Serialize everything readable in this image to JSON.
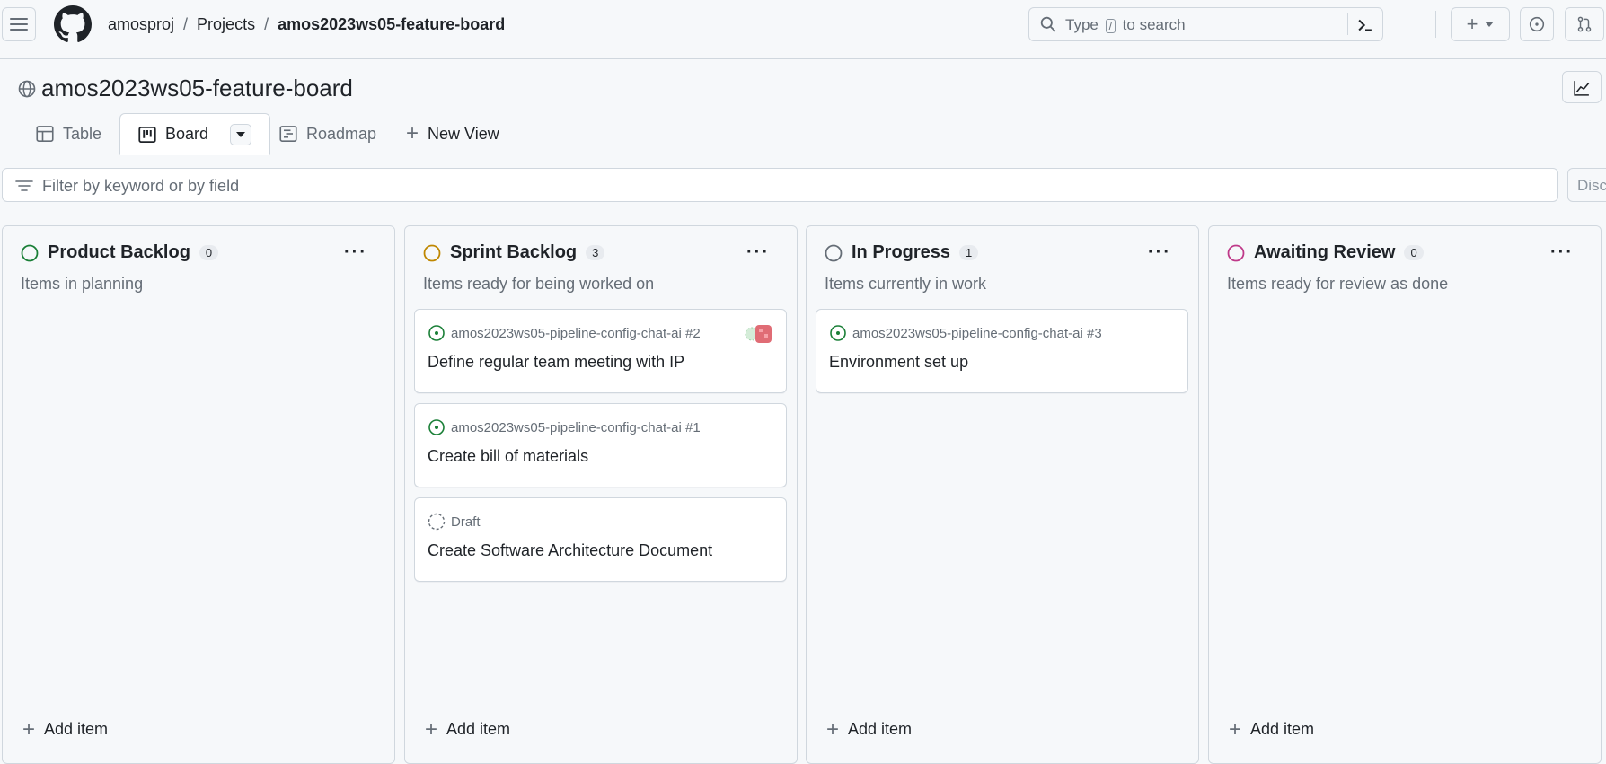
{
  "header": {
    "breadcrumbs": [
      "amosproj",
      "Projects",
      "amos2023ws05-feature-board"
    ],
    "search_prefix": "Type",
    "search_key": "/",
    "search_suffix": "to search"
  },
  "project": {
    "title": "amos2023ws05-feature-board"
  },
  "tabs": [
    {
      "label": "Table",
      "icon": "table-icon"
    },
    {
      "label": "Board",
      "icon": "board-icon",
      "active": true
    },
    {
      "label": "Roadmap",
      "icon": "roadmap-icon"
    },
    {
      "label": "New View",
      "icon": "plus-icon"
    }
  ],
  "filter": {
    "placeholder": "Filter by keyword or by field",
    "discard_label": "Discard"
  },
  "columns": [
    {
      "name": "Product Backlog",
      "count": "0",
      "description": "Items in planning",
      "status_color": "#1a7f37",
      "add_label": "Add item",
      "cards": []
    },
    {
      "name": "Sprint Backlog",
      "count": "3",
      "description": "Items ready for being worked on",
      "status_color": "#bf8700",
      "add_label": "Add item",
      "cards": [
        {
          "repo": "amos2023ws05-pipeline-config-chat-ai #2",
          "title": "Define regular team meeting with IP",
          "type": "issue",
          "has_avatar": true
        },
        {
          "repo": "amos2023ws05-pipeline-config-chat-ai #1",
          "title": "Create bill of materials",
          "type": "issue"
        },
        {
          "repo": "Draft",
          "title": "Create Software Architecture Document",
          "type": "draft"
        }
      ]
    },
    {
      "name": "In Progress",
      "count": "1",
      "description": "Items currently in work",
      "status_color": "#656d76",
      "add_label": "Add item",
      "cards": [
        {
          "repo": "amos2023ws05-pipeline-config-chat-ai #3",
          "title": "Environment set up",
          "type": "issue"
        }
      ]
    },
    {
      "name": "Awaiting Review",
      "count": "0",
      "description": "Items ready for review as done",
      "status_color": "#bf3989",
      "add_label": "Add item",
      "cards": []
    }
  ],
  "colors": {
    "issue_open": "#1a7f37",
    "border": "#d0d7de",
    "muted": "#656d76"
  }
}
